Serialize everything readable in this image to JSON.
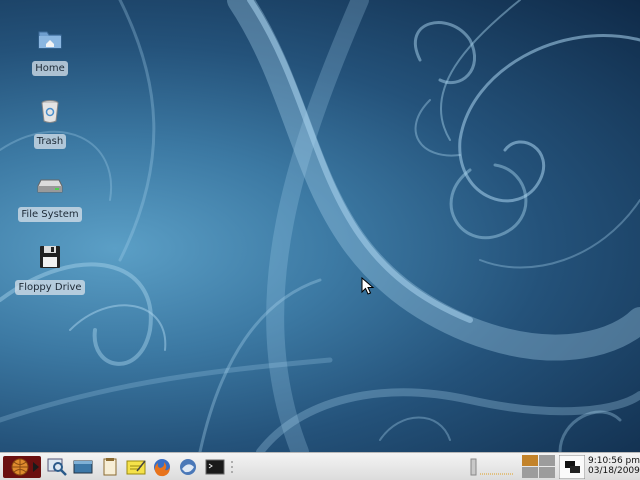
{
  "desktop": {
    "icons": [
      {
        "label": "Home",
        "icon": "folder-home-icon"
      },
      {
        "label": "Trash",
        "icon": "trash-icon"
      },
      {
        "label": "File System",
        "icon": "hard-drive-icon"
      },
      {
        "label": "Floppy Drive",
        "icon": "floppy-icon"
      }
    ]
  },
  "panel": {
    "launchers": [
      "start-menu-icon",
      "search-icon",
      "desktop-icon",
      "text-editor-icon",
      "notes-icon",
      "firefox-icon",
      "thunderbird-icon",
      "terminal-icon"
    ],
    "clock": {
      "time": "9:10:56 pm",
      "date": "03/18/2009"
    }
  },
  "colors": {
    "background_light": "#5b9fc6",
    "background_dark": "#0f2a48",
    "panel": "#e8e8e8",
    "pager_active": "#c3832a"
  }
}
